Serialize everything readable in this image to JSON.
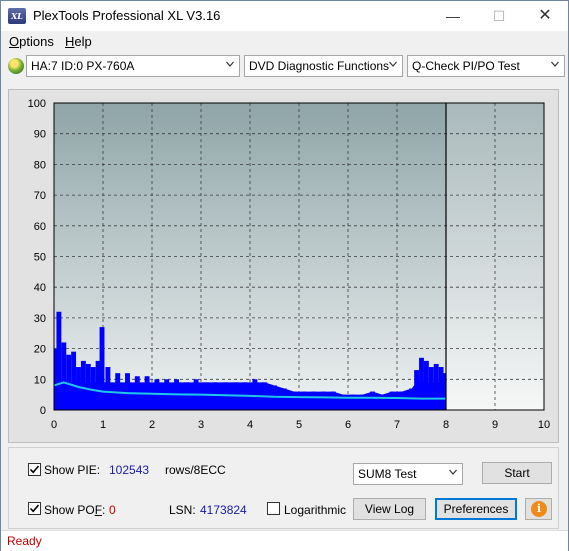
{
  "window": {
    "title": "PlexTools Professional XL V3.16",
    "icon_text": "XL"
  },
  "menu": [
    {
      "label": "Options",
      "accel": "O"
    },
    {
      "label": "Help",
      "accel": "H"
    }
  ],
  "toolbar": {
    "drive": "HA:7 ID:0  PX-760A",
    "function": "DVD Diagnostic Functions",
    "test": "Q-Check PI/PO Test"
  },
  "chart_data": {
    "type": "bar",
    "x_label": "",
    "y_label": "",
    "xlim": [
      0,
      10
    ],
    "ylim": [
      0,
      100
    ],
    "x_ticks": [
      "0",
      "1",
      "2",
      "3",
      "4",
      "5",
      "6",
      "7",
      "8",
      "9",
      "10"
    ],
    "y_ticks": [
      "0",
      "10",
      "20",
      "30",
      "40",
      "50",
      "60",
      "70",
      "80",
      "90",
      "100"
    ],
    "grid": true,
    "end_marker_x": 8,
    "series": [
      {
        "name": "PIE",
        "color": "#0000ff",
        "x": [
          0.05,
          0.1,
          0.2,
          0.3,
          0.4,
          0.5,
          0.6,
          0.7,
          0.8,
          0.9,
          0.98,
          1.1,
          1.3,
          1.5,
          1.7,
          1.9,
          2.1,
          2.3,
          2.5,
          2.7,
          2.9,
          3.1,
          3.3,
          3.5,
          3.7,
          3.9,
          4.1,
          4.3,
          4.5,
          4.7,
          4.9,
          5.1,
          5.3,
          5.5,
          5.7,
          5.9,
          6.1,
          6.3,
          6.5,
          6.7,
          6.9,
          7.1,
          7.3,
          7.4,
          7.5,
          7.6,
          7.7,
          7.8,
          7.9,
          7.95
        ],
        "y": [
          20,
          32,
          22,
          18,
          19,
          14,
          16,
          15,
          14,
          16,
          27,
          14,
          12,
          12,
          11,
          11,
          10,
          10,
          10,
          9,
          10,
          9,
          9,
          9,
          9,
          9,
          10,
          9,
          8,
          7,
          6,
          6,
          6,
          6,
          6,
          5,
          5,
          5,
          6,
          5,
          6,
          6,
          7,
          13,
          17,
          16,
          14,
          15,
          14,
          12
        ]
      },
      {
        "name": "PIE avg",
        "color": "#1ec8e6",
        "x": [
          0,
          0.2,
          0.5,
          0.8,
          1,
          1.5,
          2,
          2.5,
          3,
          3.5,
          4,
          4.5,
          5,
          5.5,
          6,
          6.5,
          7,
          7.5,
          8
        ],
        "y": [
          8,
          9,
          7.5,
          6.5,
          6,
          5.5,
          5.3,
          5.1,
          5,
          4.8,
          4.6,
          4.3,
          4.2,
          4.1,
          4,
          4,
          3.9,
          3.7,
          3.7
        ]
      }
    ]
  },
  "bottom": {
    "show_pie_label": "Show PIE:",
    "pie_value": "102543",
    "pie_unit": "rows/8ECC",
    "show_pof_label": "Show POF:",
    "pof_value": "0",
    "lsn_label": "LSN:",
    "lsn_value": "4173824",
    "log_label": "Logarithmic",
    "sum_select": "SUM8 Test",
    "start_label": "Start",
    "viewlog_label": "View Log",
    "preferences_label": "Preferences",
    "info_icon": "i"
  },
  "status": "Ready",
  "colors": {
    "pie_value": "#1a1aa6",
    "pof_value": "#d00000",
    "status": "#c00000"
  }
}
